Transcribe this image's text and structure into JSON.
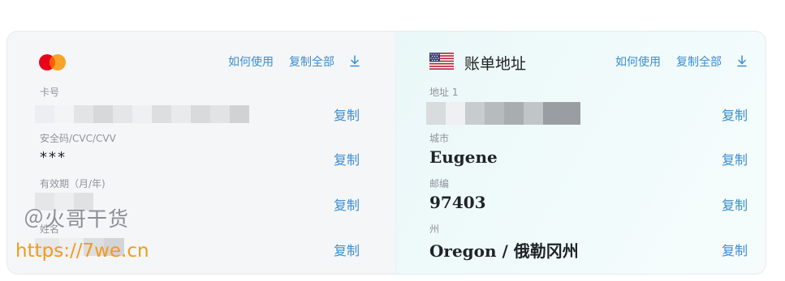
{
  "card": {
    "how_to_use": "如何使用",
    "copy_all": "复制全部",
    "fields": [
      {
        "label": "卡号",
        "value": "",
        "copy": "复制"
      },
      {
        "label": "安全码/CVC/CVV",
        "value": "***",
        "copy": "复制"
      },
      {
        "label": "有效期（月/年)",
        "value": "",
        "copy": "复制"
      },
      {
        "label": "姓名",
        "value": "",
        "copy": "复制"
      }
    ]
  },
  "billing": {
    "title": "账单地址",
    "how_to_use": "如何使用",
    "copy_all": "复制全部",
    "fields": [
      {
        "label": "地址 1",
        "value": "",
        "copy": "复制"
      },
      {
        "label": "城市",
        "value": "Eugene",
        "copy": "复制"
      },
      {
        "label": "邮编",
        "value": "97403",
        "copy": "复制"
      },
      {
        "label": "州",
        "value": "Oregon / 俄勒冈州",
        "copy": "复制"
      }
    ]
  },
  "watermark": {
    "line1": "＠火哥干货",
    "line2": "https://7we.cn"
  },
  "colors": {
    "link": "#3b8ed3",
    "mastercard_red": "#eb001b",
    "mastercard_orange": "#f79e1b"
  }
}
